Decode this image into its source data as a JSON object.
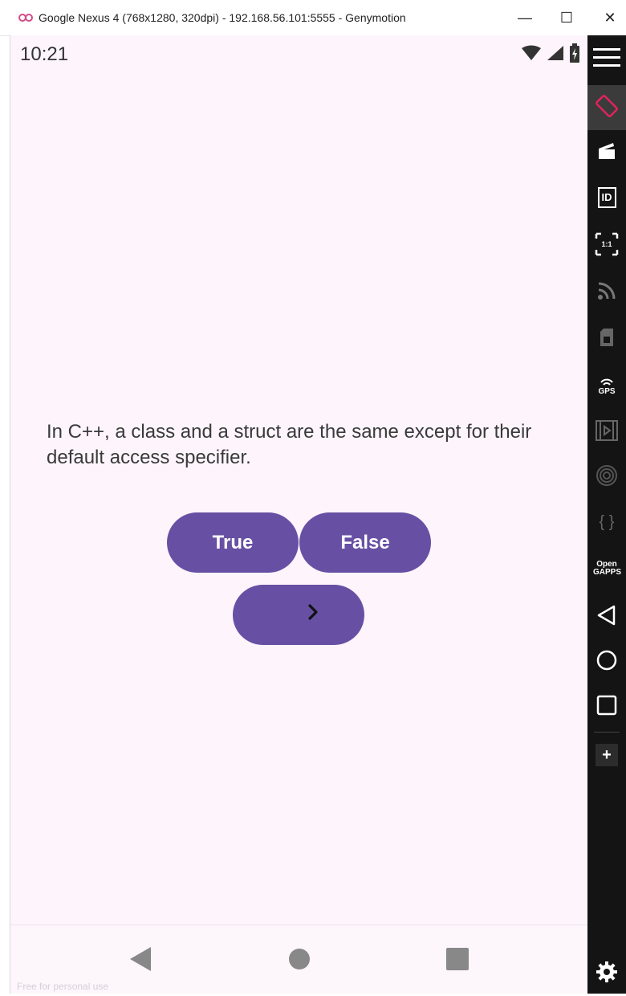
{
  "window": {
    "title": "Google Nexus 4 (768x1280, 320dpi) - 192.168.56.101:5555 - Genymotion",
    "minimize_label": "—",
    "maximize_label": "☐",
    "close_label": "✕"
  },
  "status_bar": {
    "time": "10:21"
  },
  "quiz": {
    "question": "In C++, a class and a struct are the same except for their default access specifier.",
    "true_label": "True",
    "false_label": "False",
    "next_label": "›"
  },
  "sidebar": {
    "gps_label": "GPS",
    "id_label": "ID",
    "ratio_label": "1:1",
    "braces_label": "{ }",
    "opengapps_label": "Open GAPPS",
    "plus_label": "+"
  },
  "watermark": "Free for personal use",
  "colors": {
    "accent": "#6750a4",
    "screen_bg": "#fef5fc",
    "sidebar_bg": "#141414",
    "rotate_icon": "#e0245e"
  }
}
